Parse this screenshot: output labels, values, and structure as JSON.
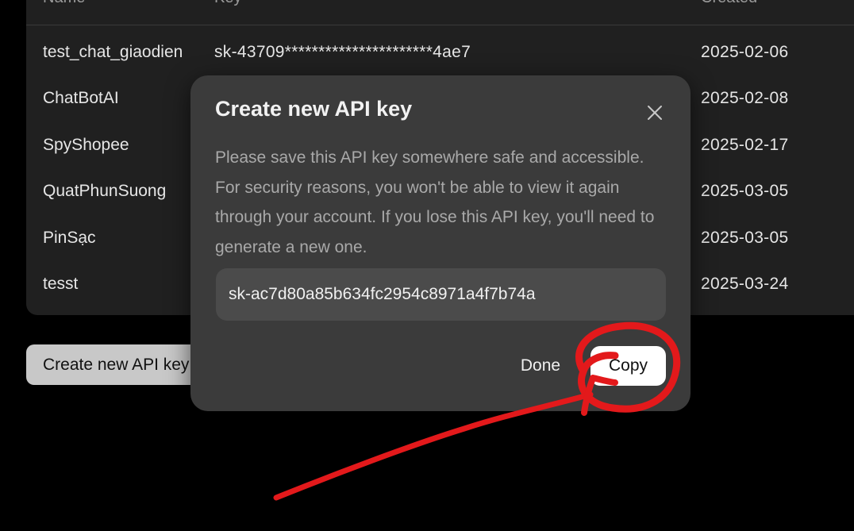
{
  "table": {
    "headers": {
      "name": "Name",
      "key": "Key",
      "created": "Created"
    },
    "rows": [
      {
        "name": "test_chat_giaodien",
        "key": "sk-43709**********************4ae7",
        "created": "2025-02-06"
      },
      {
        "name": "ChatBotAI",
        "key": "",
        "created": "2025-02-08"
      },
      {
        "name": "SpyShopee",
        "key": "",
        "created": "2025-02-17"
      },
      {
        "name": "QuatPhunSuong",
        "key": "",
        "created": "2025-03-05"
      },
      {
        "name": "PinSạc",
        "key": "",
        "created": "2025-03-05"
      },
      {
        "name": "tesst",
        "key": "",
        "created": "2025-03-24"
      }
    ]
  },
  "create_button_label": "Create new API key",
  "modal": {
    "title": "Create new API key",
    "description": "Please save this API key somewhere safe and accessible. For security reasons, you won't be able to view it again through your account. If you lose this API key, you'll need to generate a new one.",
    "api_key_value": "sk-ac7d80a85b634fc2954c8971a4f7b74a",
    "done_label": "Done",
    "copy_label": "Copy"
  },
  "colors": {
    "annotation": "#e3191b",
    "modal_bg": "#3b3b3b",
    "field_bg": "#4b4b4b",
    "table_bg": "#202020"
  },
  "icons": {
    "close": "close-icon"
  }
}
